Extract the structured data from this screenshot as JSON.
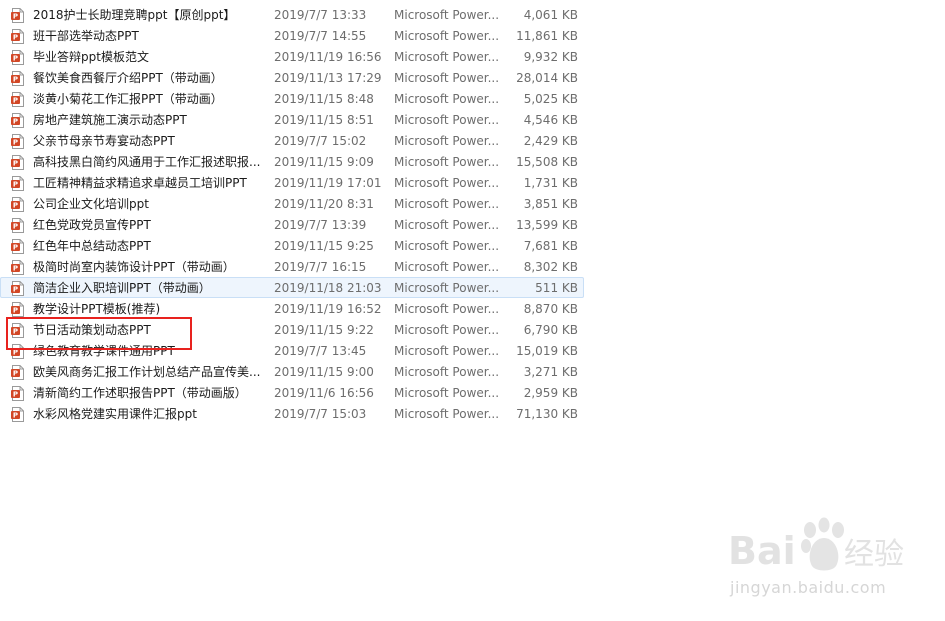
{
  "files": [
    {
      "name": "2018护士长助理竞聘ppt【原创ppt】",
      "modified": "2019/7/7 13:33",
      "type": "Microsoft Power...",
      "size": "4,061 KB"
    },
    {
      "name": "班干部选举动态PPT",
      "modified": "2019/7/7 14:55",
      "type": "Microsoft Power...",
      "size": "11,861 KB"
    },
    {
      "name": "毕业答辩ppt模板范文",
      "modified": "2019/11/19 16:56",
      "type": "Microsoft Power...",
      "size": "9,932 KB"
    },
    {
      "name": "餐饮美食西餐厅介绍PPT（带动画）",
      "modified": "2019/11/13 17:29",
      "type": "Microsoft Power...",
      "size": "28,014 KB"
    },
    {
      "name": "淡黄小菊花工作汇报PPT（带动画）",
      "modified": "2019/11/15 8:48",
      "type": "Microsoft Power...",
      "size": "5,025 KB"
    },
    {
      "name": "房地产建筑施工演示动态PPT",
      "modified": "2019/11/15 8:51",
      "type": "Microsoft Power...",
      "size": "4,546 KB"
    },
    {
      "name": "父亲节母亲节寿宴动态PPT",
      "modified": "2019/7/7 15:02",
      "type": "Microsoft Power...",
      "size": "2,429 KB"
    },
    {
      "name": "高科技黑白简约风通用于工作汇报述职报...",
      "modified": "2019/11/15 9:09",
      "type": "Microsoft Power...",
      "size": "15,508 KB"
    },
    {
      "name": "工匠精神精益求精追求卓越员工培训PPT",
      "modified": "2019/11/19 17:01",
      "type": "Microsoft Power...",
      "size": "1,731 KB"
    },
    {
      "name": "公司企业文化培训ppt",
      "modified": "2019/11/20 8:31",
      "type": "Microsoft Power...",
      "size": "3,851 KB"
    },
    {
      "name": "红色党政党员宣传PPT",
      "modified": "2019/7/7 13:39",
      "type": "Microsoft Power...",
      "size": "13,599 KB"
    },
    {
      "name": "红色年中总结动态PPT",
      "modified": "2019/11/15 9:25",
      "type": "Microsoft Power...",
      "size": "7,681 KB"
    },
    {
      "name": "极简时尚室内装饰设计PPT（带动画）",
      "modified": "2019/7/7 16:15",
      "type": "Microsoft Power...",
      "size": "8,302 KB"
    },
    {
      "name": "简洁企业入职培训PPT（带动画）",
      "modified": "2019/11/18 21:03",
      "type": "Microsoft Power...",
      "size": "511 KB",
      "hovered": true
    },
    {
      "name": "教学设计PPT模板(推荐)",
      "modified": "2019/11/19 16:52",
      "type": "Microsoft Power...",
      "size": "8,870 KB"
    },
    {
      "name": "节日活动策划动态PPT",
      "modified": "2019/11/15 9:22",
      "type": "Microsoft Power...",
      "size": "6,790 KB"
    },
    {
      "name": "绿色教育教学课件通用PPT",
      "modified": "2019/7/7 13:45",
      "type": "Microsoft Power...",
      "size": "15,019 KB"
    },
    {
      "name": "欧美风商务汇报工作计划总结产品宣传美...",
      "modified": "2019/11/15 9:00",
      "type": "Microsoft Power...",
      "size": "3,271 KB"
    },
    {
      "name": "清新简约工作述职报告PPT（带动画版）",
      "modified": "2019/11/6 16:56",
      "type": "Microsoft Power...",
      "size": "2,959 KB"
    },
    {
      "name": "水彩风格党建实用课件汇报ppt",
      "modified": "2019/7/7 15:03",
      "type": "Microsoft Power...",
      "size": "71,130 KB"
    }
  ],
  "watermark": {
    "logo_text": "Baidu经验",
    "url_text": "jingyan.baidu.com"
  },
  "colors": {
    "highlight_border": "#e8221e",
    "hover_background": "#eef5fd",
    "hover_border": "#c9dff6",
    "ppt_icon": "#d24726"
  }
}
